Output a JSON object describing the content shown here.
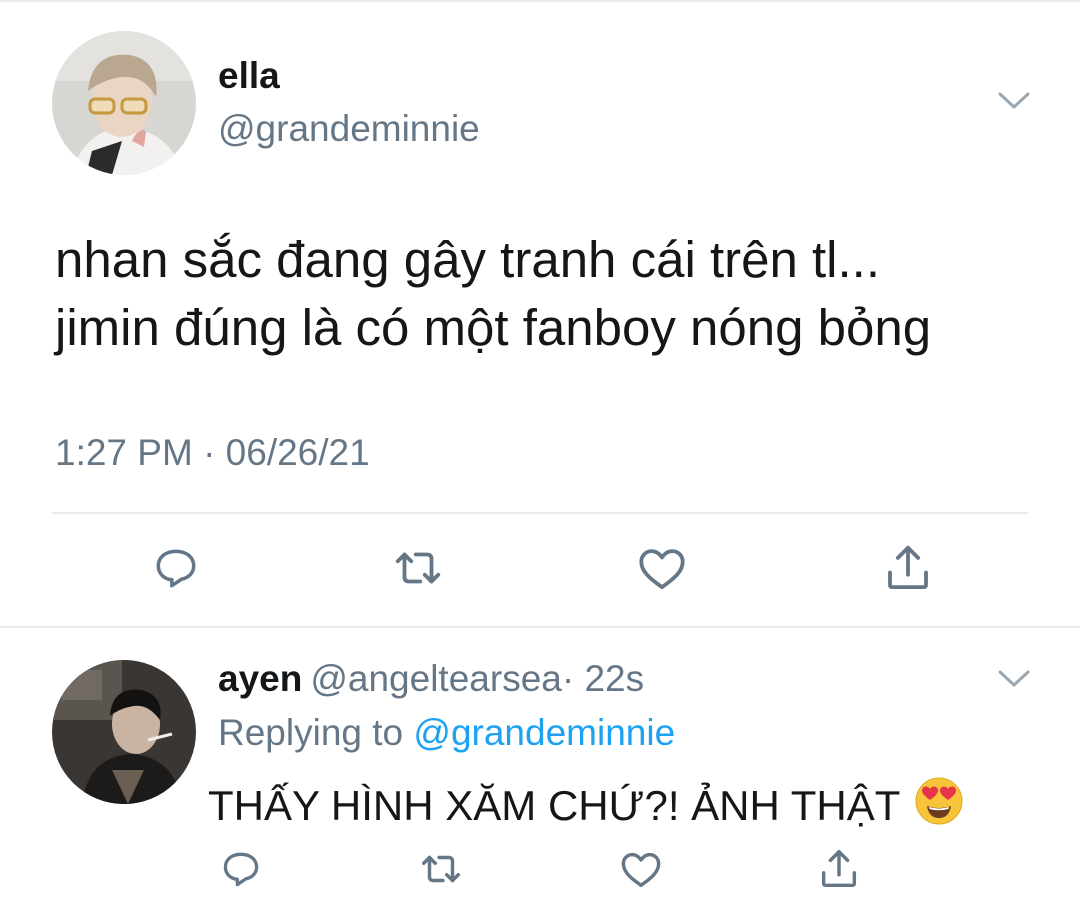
{
  "main_tweet": {
    "author_name": "ella",
    "author_handle": "@grandeminnie",
    "text_lines": [
      "nhan sắc đang gây tranh cái trên tl...",
      "jimin đúng là có một fanboy nóng bỏng"
    ],
    "timestamp": "1:27 PM · 06/26/21",
    "actions": [
      "reply-icon",
      "retweet-icon",
      "like-icon",
      "share-icon"
    ],
    "menu_icon": "chevron-down-icon"
  },
  "reply": {
    "author_name": "ayen",
    "author_handle": "@angeltearsea",
    "time_ago": "· 22s",
    "replying_label": "Replying to",
    "replying_mention": "@grandeminnie",
    "text": "THẤY HÌNH XĂM CHỨ?! ẢNH THẬT",
    "emoji": "smiling-face-with-heart-eyes",
    "actions": [
      "reply-icon",
      "retweet-icon",
      "like-icon",
      "share-icon"
    ],
    "menu_icon": "chevron-down-icon"
  },
  "colors": {
    "text": "#14171a",
    "secondary": "#657786",
    "accent": "#1da1f2",
    "divider": "#e6ecf0"
  }
}
